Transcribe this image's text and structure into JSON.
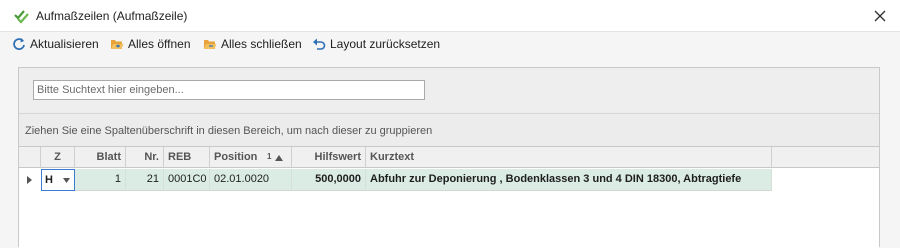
{
  "window": {
    "title": "Aufmaßzeilen (Aufmaßzeile)"
  },
  "toolbar": {
    "refresh_label": "Aktualisieren",
    "open_all_label": "Alles öffnen",
    "close_all_label": "Alles schließen",
    "reset_layout_label": "Layout zurücksetzen"
  },
  "search": {
    "placeholder": "Bitte Suchtext hier eingeben..."
  },
  "grouping": {
    "hint": "Ziehen Sie eine Spaltenüberschrift in diesen Bereich, um nach dieser zu gruppieren"
  },
  "grid": {
    "columns": {
      "z": "Z",
      "blatt": "Blatt",
      "nr": "Nr.",
      "reb": "REB",
      "position": "Position",
      "sort_index": "1",
      "hilfswert": "Hilfswert",
      "kurztext": "Kurztext"
    },
    "rows": [
      {
        "z": "H",
        "blatt": "1",
        "nr": "21",
        "reb": "0001C0",
        "position": "02.01.0020",
        "hilfswert": "500,0000",
        "kurztext": "Abfuhr zur Deponierung , Bodenklassen 3 und 4 DIN 18300, Abtragtiefe"
      }
    ]
  },
  "colors": {
    "row_selected": "#dbece5",
    "accent_blue": "#2f6fb5",
    "folder_orange": "#e8a33a",
    "check_green": "#4a9a3a"
  }
}
